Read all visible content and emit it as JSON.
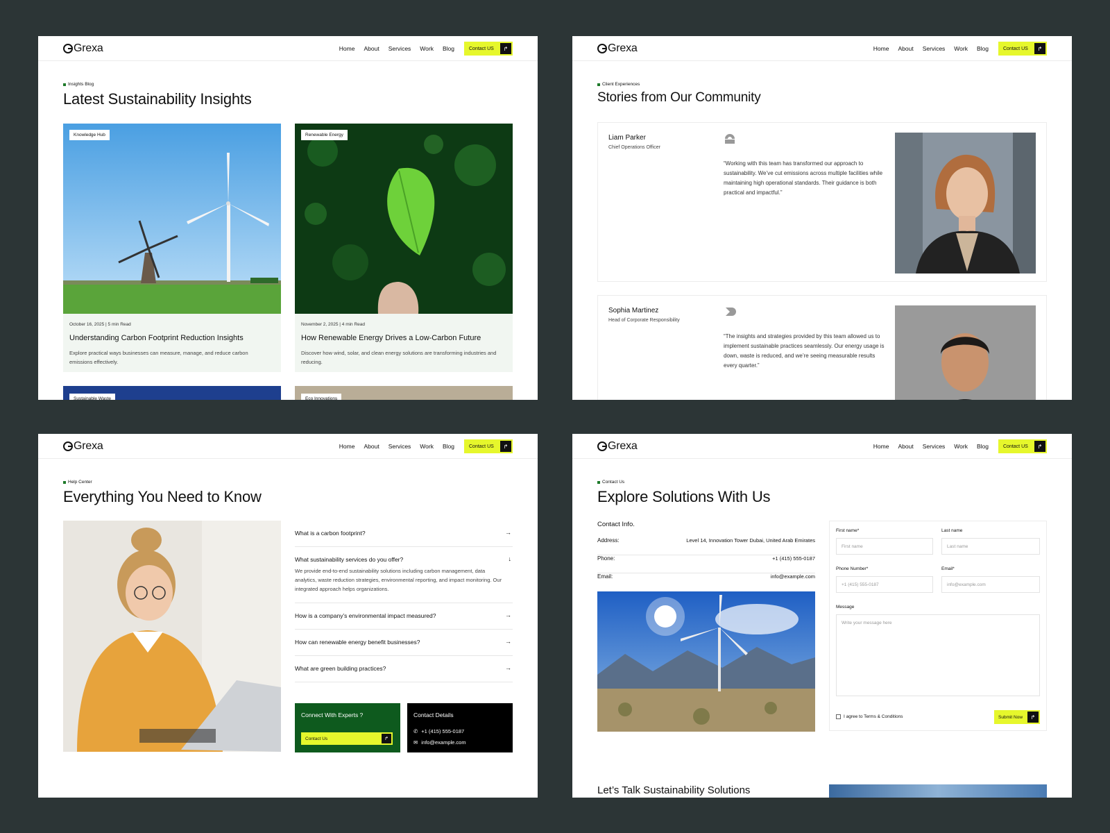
{
  "nav": {
    "logo": "Grexa",
    "items": [
      "Home",
      "About",
      "Services",
      "Work",
      "Blog"
    ],
    "cta": "Contact US"
  },
  "blog": {
    "tag": "Insights Blog",
    "title": "Latest Sustainability Insights",
    "cards": [
      {
        "badge": "Knowledge Hub",
        "meta": "October 16, 2025  |  5 min Read",
        "title": "Understanding Carbon Footprint Reduction Insights",
        "desc": "Explore practical ways businesses can measure, manage, and reduce carbon emissions effectively."
      },
      {
        "badge": "Renewable Energy",
        "meta": "November 2, 2025  |  4 min Read",
        "title": "How Renewable Energy Drives a Low-Carbon Future",
        "desc": "Discover how wind, solar, and clean energy solutions are transforming industries and reducing."
      }
    ],
    "more_badges": [
      "Sustainable Waste",
      "Eco Innovations"
    ]
  },
  "stories": {
    "tag": "Client Experiences",
    "title": "Stories from Our Community",
    "items": [
      {
        "name": "Liam Parker",
        "role": "Chief Operations Officer",
        "quote": "“Working with this team has transformed our approach to sustainability. We’ve cut emissions across multiple facilities while maintaining high operational standards. Their guidance is both practical and impactful.”"
      },
      {
        "name": "Sophia Martinez",
        "role": "Head of Corporate Responsibility",
        "quote": "“The insights and strategies provided by this team allowed us to implement sustainable practices seamlessly. Our energy usage is down, waste is reduced, and we’re seeing measurable results every quarter.”"
      }
    ]
  },
  "faq": {
    "tag": "Help Center",
    "title": "Everything You Need to Know",
    "items": [
      {
        "q": "What is a carbon footprint?",
        "a": ""
      },
      {
        "q": "What sustainability services do you offer?",
        "a": "We provide end-to-end sustainability solutions including carbon management, data analytics, waste reduction strategies, environmental reporting, and impact monitoring. Our integrated approach helps organizations."
      },
      {
        "q": "How is a company’s environmental impact measured?",
        "a": ""
      },
      {
        "q": "How can renewable energy benefit businesses?",
        "a": ""
      },
      {
        "q": "What are green building practices?",
        "a": ""
      }
    ],
    "connect": {
      "title": "Connect With Experts ?",
      "button": "Contact Us"
    },
    "details": {
      "title": "Contact Details",
      "phone": "+1 (415) 555-0187",
      "email": "info@example.com"
    }
  },
  "contact": {
    "tag": "Contact Us",
    "title": "Explore Solutions With Us",
    "info_title": "Contact Info.",
    "rows": [
      {
        "label": "Address:",
        "value": "Level 14, Innovation Tower Dubai, United Arab Emirates"
      },
      {
        "label": "Phone:",
        "value": "+1 (415) 555-0187"
      },
      {
        "label": "Email:",
        "value": "info@example.com"
      }
    ],
    "form": {
      "first_label": "First name*",
      "first_ph": "First name",
      "last_label": "Last name",
      "last_ph": "Last name",
      "phone_label": "Phone Number*",
      "phone_ph": "+1 (415) 555-0187",
      "email_label": "Email*",
      "email_ph": "info@example.com",
      "message_label": "Message",
      "message_ph": "Write your message here",
      "agree": "I agree to  Terms & Conditions",
      "submit": "Submit Now"
    },
    "bottom_title": "Let’s Talk Sustainability Solutions"
  },
  "colors": {
    "accent": "#e6f72c",
    "green": "#0e5a1e",
    "background": "#2c3536"
  },
  "icons": [
    "arrow-up-right-icon",
    "chevron-right-icon",
    "chevron-down-icon",
    "phone-icon",
    "mail-icon",
    "company-logo-icon"
  ]
}
